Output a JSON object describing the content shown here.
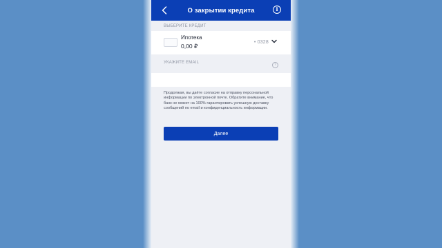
{
  "navbar": {
    "title": "О закрытии кредита",
    "back_icon": "chevron-left-icon",
    "info_icon": "info-icon",
    "info_glyph": "i"
  },
  "loan_section": {
    "label": "ВЫБЕРИТЕ КРЕДИТ",
    "selected": {
      "name": "Ипотека",
      "amount": "0,00 ₽",
      "account_mask": "• 0328"
    }
  },
  "email_section": {
    "label": "УКАЖИТЕ EMAIL",
    "help_glyph": "?",
    "value": ""
  },
  "consent_text": "Продолжая, вы даёте согласие на отправку персональной информации по электронной почте. Обратите внимание, что банк не может на 100% гарантировать успешную доставку сообщений по email и конфиденциальность информации.",
  "next_button": {
    "label": "Далее"
  },
  "colors": {
    "background": "#5b8fc6",
    "brand_blue": "#0b3fb5",
    "screen_bg": "#eef0f5"
  }
}
